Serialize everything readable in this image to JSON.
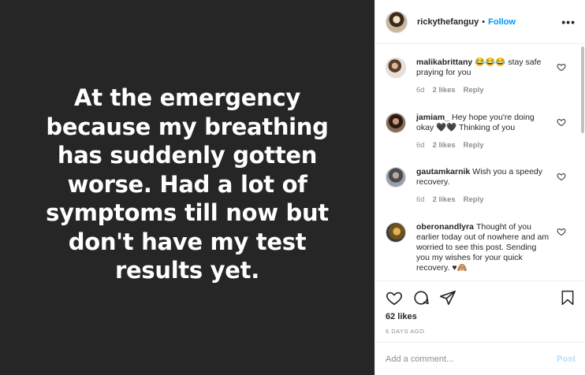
{
  "post": {
    "text": "At the emergency because my breathing has suddenly gotten worse. Had a lot of symptoms till now but don't have my test results yet."
  },
  "header": {
    "username": "rickythefanguy",
    "dot": "•",
    "follow_label": "Follow",
    "more_label": "•••"
  },
  "comments": [
    {
      "user": "malikabrittany",
      "text": "😂😂😂 stay safe praying for you",
      "age": "6d",
      "likes": "2 likes",
      "reply": "Reply"
    },
    {
      "user": "jamiam_",
      "text": "Hey hope you're doing okay 🖤🖤 Thinking of you",
      "age": "6d",
      "likes": "2 likes",
      "reply": "Reply"
    },
    {
      "user": "gautamkarnik",
      "text": "Wish you a speedy recovery.",
      "age": "6d",
      "likes": "2 likes",
      "reply": "Reply"
    },
    {
      "user": "oberonandlyra",
      "text": "Thought of you earlier today out of nowhere and am worried to see this post. Sending you my wishes for your quick recovery. ♥🙈",
      "age": "",
      "likes": "",
      "reply": ""
    }
  ],
  "footer": {
    "likes": "62 likes",
    "time_ago": "6 DAYS AGO",
    "add_comment_placeholder": "Add a comment...",
    "post_label": "Post"
  },
  "colors": {
    "image_bg": "#262626",
    "link": "#0095f6",
    "muted": "#8e8e8e"
  },
  "icons": [
    "heart-icon",
    "comment-icon",
    "share-icon",
    "bookmark-icon"
  ]
}
